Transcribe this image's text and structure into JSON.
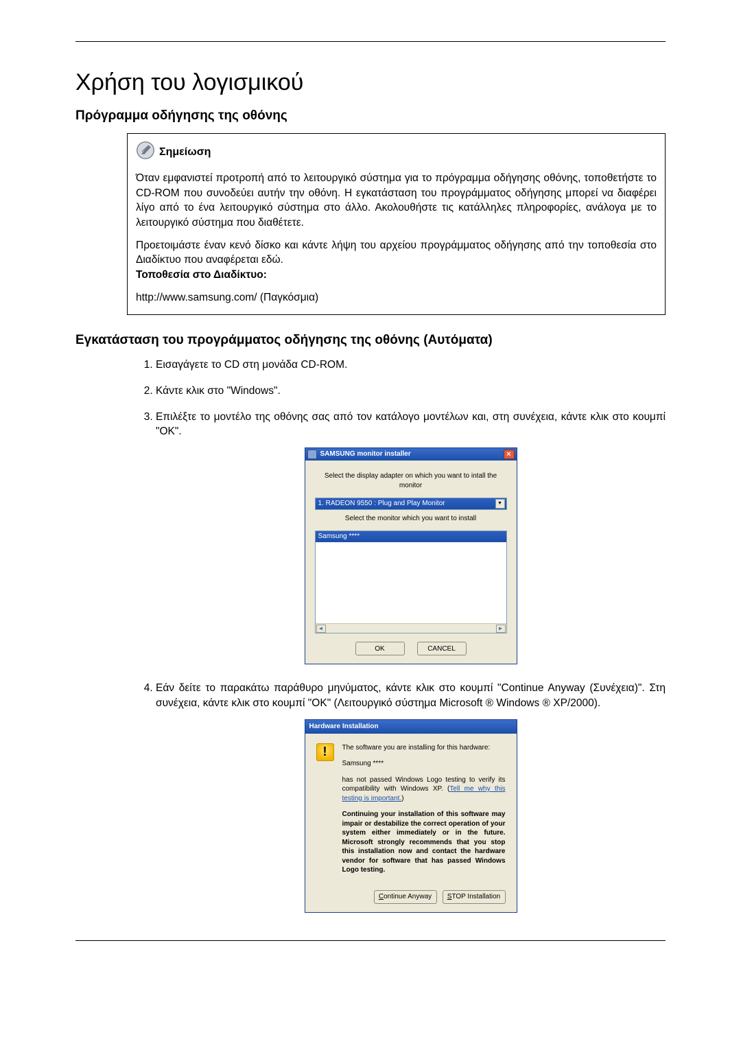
{
  "page": {
    "title": "Χρήση του λογισμικού",
    "section_driver": "Πρόγραμμα οδήγησης της οθόνης",
    "section_install": "Εγκατάσταση του προγράμματος οδήγησης της οθόνης (Αυτόματα)"
  },
  "note": {
    "label": "Σημείωση",
    "p1": "Όταν εμφανιστεί προτροπή από το λειτουργικό σύστημα για το πρόγραμμα οδήγησης οθόνης, τοποθετήστε το CD-ROM που συνοδεύει αυτήν την οθόνη. Η εγκατάσταση του προγράμματος οδήγησης μπορεί να διαφέρει λίγο από το ένα λειτουργικό σύστημα στο άλλο. Ακολουθήστε τις κατάλληλες πληροφορίες, ανάλογα με το λειτουργικό σύστημα που διαθέτετε.",
    "p2a": "Προετοιμάστε έναν κενό δίσκο και κάντε λήψη του αρχείου προγράμματος οδήγησης από την τοποθεσία στο Διαδίκτυο που αναφέρεται εδώ.",
    "p2b": "Τοποθεσία στο Διαδίκτυο:",
    "url": "http://www.samsung.com/ (Παγκόσμια)"
  },
  "steps": {
    "s1": "Εισαγάγετε το CD στη μονάδα CD-ROM.",
    "s2": "Κάντε κλικ στο \"Windows\".",
    "s3": "Επιλέξτε το μοντέλο της οθόνης σας από τον κατάλογο μοντέλων και, στη συνέχεια, κάντε κλικ στο κουμπί \"OK\".",
    "s4": "Εάν δείτε το παρακάτω παράθυρο μηνύματος, κάντε κλικ στο κουμπί \"Continue Anyway (Συνέχεια)\". Στη συνέχεια, κάντε κλικ στο κουμπί \"OK\" (Λειτουργικό σύστημα Microsoft ® Windows ® XP/2000)."
  },
  "installer_dialog": {
    "title": "SAMSUNG monitor installer",
    "label_adapter": "Select the display adapter on which you want to intall the monitor",
    "adapter_value": "1. RADEON 9550 : Plug and Play Monitor",
    "label_monitor": "Select the monitor which you want to install",
    "list_selected": "Samsung ****",
    "btn_ok": "OK",
    "btn_cancel": "CANCEL"
  },
  "hw_dialog": {
    "title": "Hardware Installation",
    "p1": "The software you are installing for this hardware:",
    "device": "Samsung ****",
    "p2a": "has not passed Windows Logo testing to verify its compatibility with Windows XP. (",
    "link": "Tell me why this testing is important.",
    "p2b": ")",
    "p3": "Continuing your installation of this software may impair or destabilize the correct operation of your system either immediately or in the future. Microsoft strongly recommends that you stop this installation now and contact the hardware vendor for software that has passed Windows Logo testing.",
    "btn_continue": "Continue Anyway",
    "btn_stop": "STOP Installation"
  }
}
